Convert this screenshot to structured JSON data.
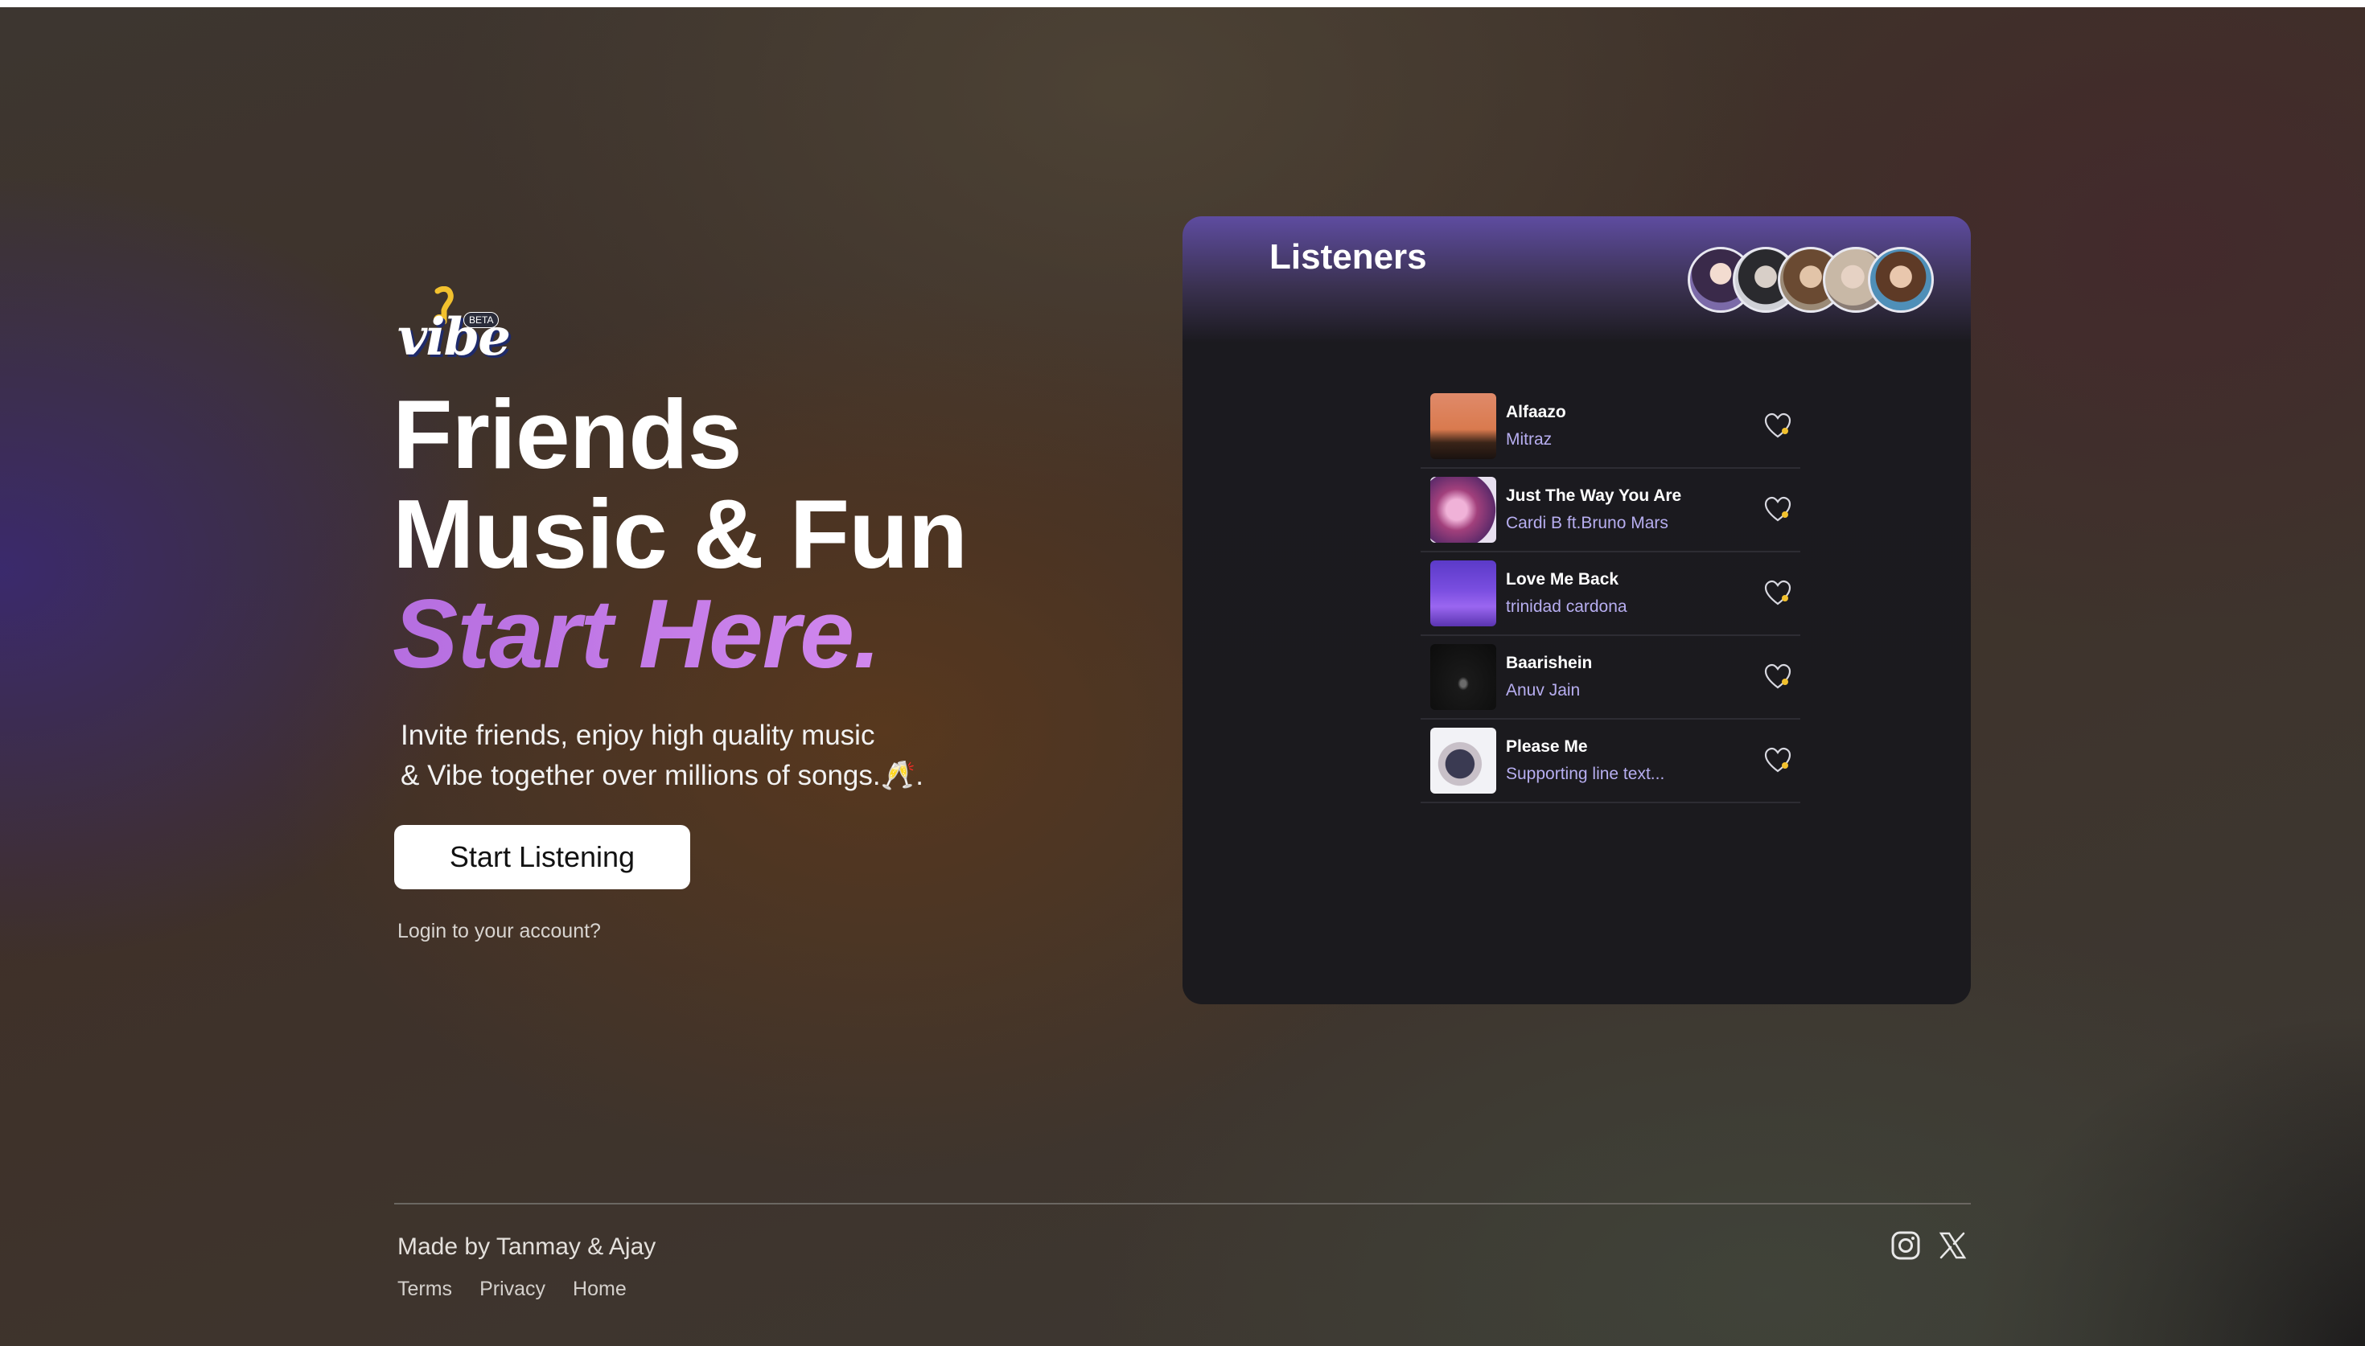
{
  "brand": {
    "logo_text": "vibe",
    "badge": "BETA"
  },
  "hero": {
    "line1": "Friends",
    "line2": "Music & Fun",
    "line3": "Start Here.",
    "subtitle_line1": "Invite friends, enjoy high quality music",
    "subtitle_line2": "& Vibe together over millions of songs.🥂.",
    "cta_label": "Start Listening",
    "login_link": "Login to your account?"
  },
  "listeners_card": {
    "title": "Listeners",
    "avatar_count": 5,
    "tracks": [
      {
        "title": "Alfaazo",
        "artist": "Mitraz"
      },
      {
        "title": "Just The Way You Are",
        "artist": "Cardi B ft.Bruno Mars"
      },
      {
        "title": "Love Me Back",
        "artist": "trinidad cardona"
      },
      {
        "title": "Baarishein",
        "artist": "Anuv Jain"
      },
      {
        "title": "Please Me",
        "artist": "Supporting line text..."
      }
    ]
  },
  "footer": {
    "credit": "Made by Tanmay & Ajay",
    "links": [
      "Terms",
      "Privacy",
      "Home"
    ],
    "social": [
      "instagram-icon",
      "x-icon"
    ]
  },
  "colors": {
    "accent_purple": "#c77ae8",
    "artist_text": "#b7aef0",
    "card_bg": "#1b1a1e",
    "card_header": "#5e4ca0"
  }
}
